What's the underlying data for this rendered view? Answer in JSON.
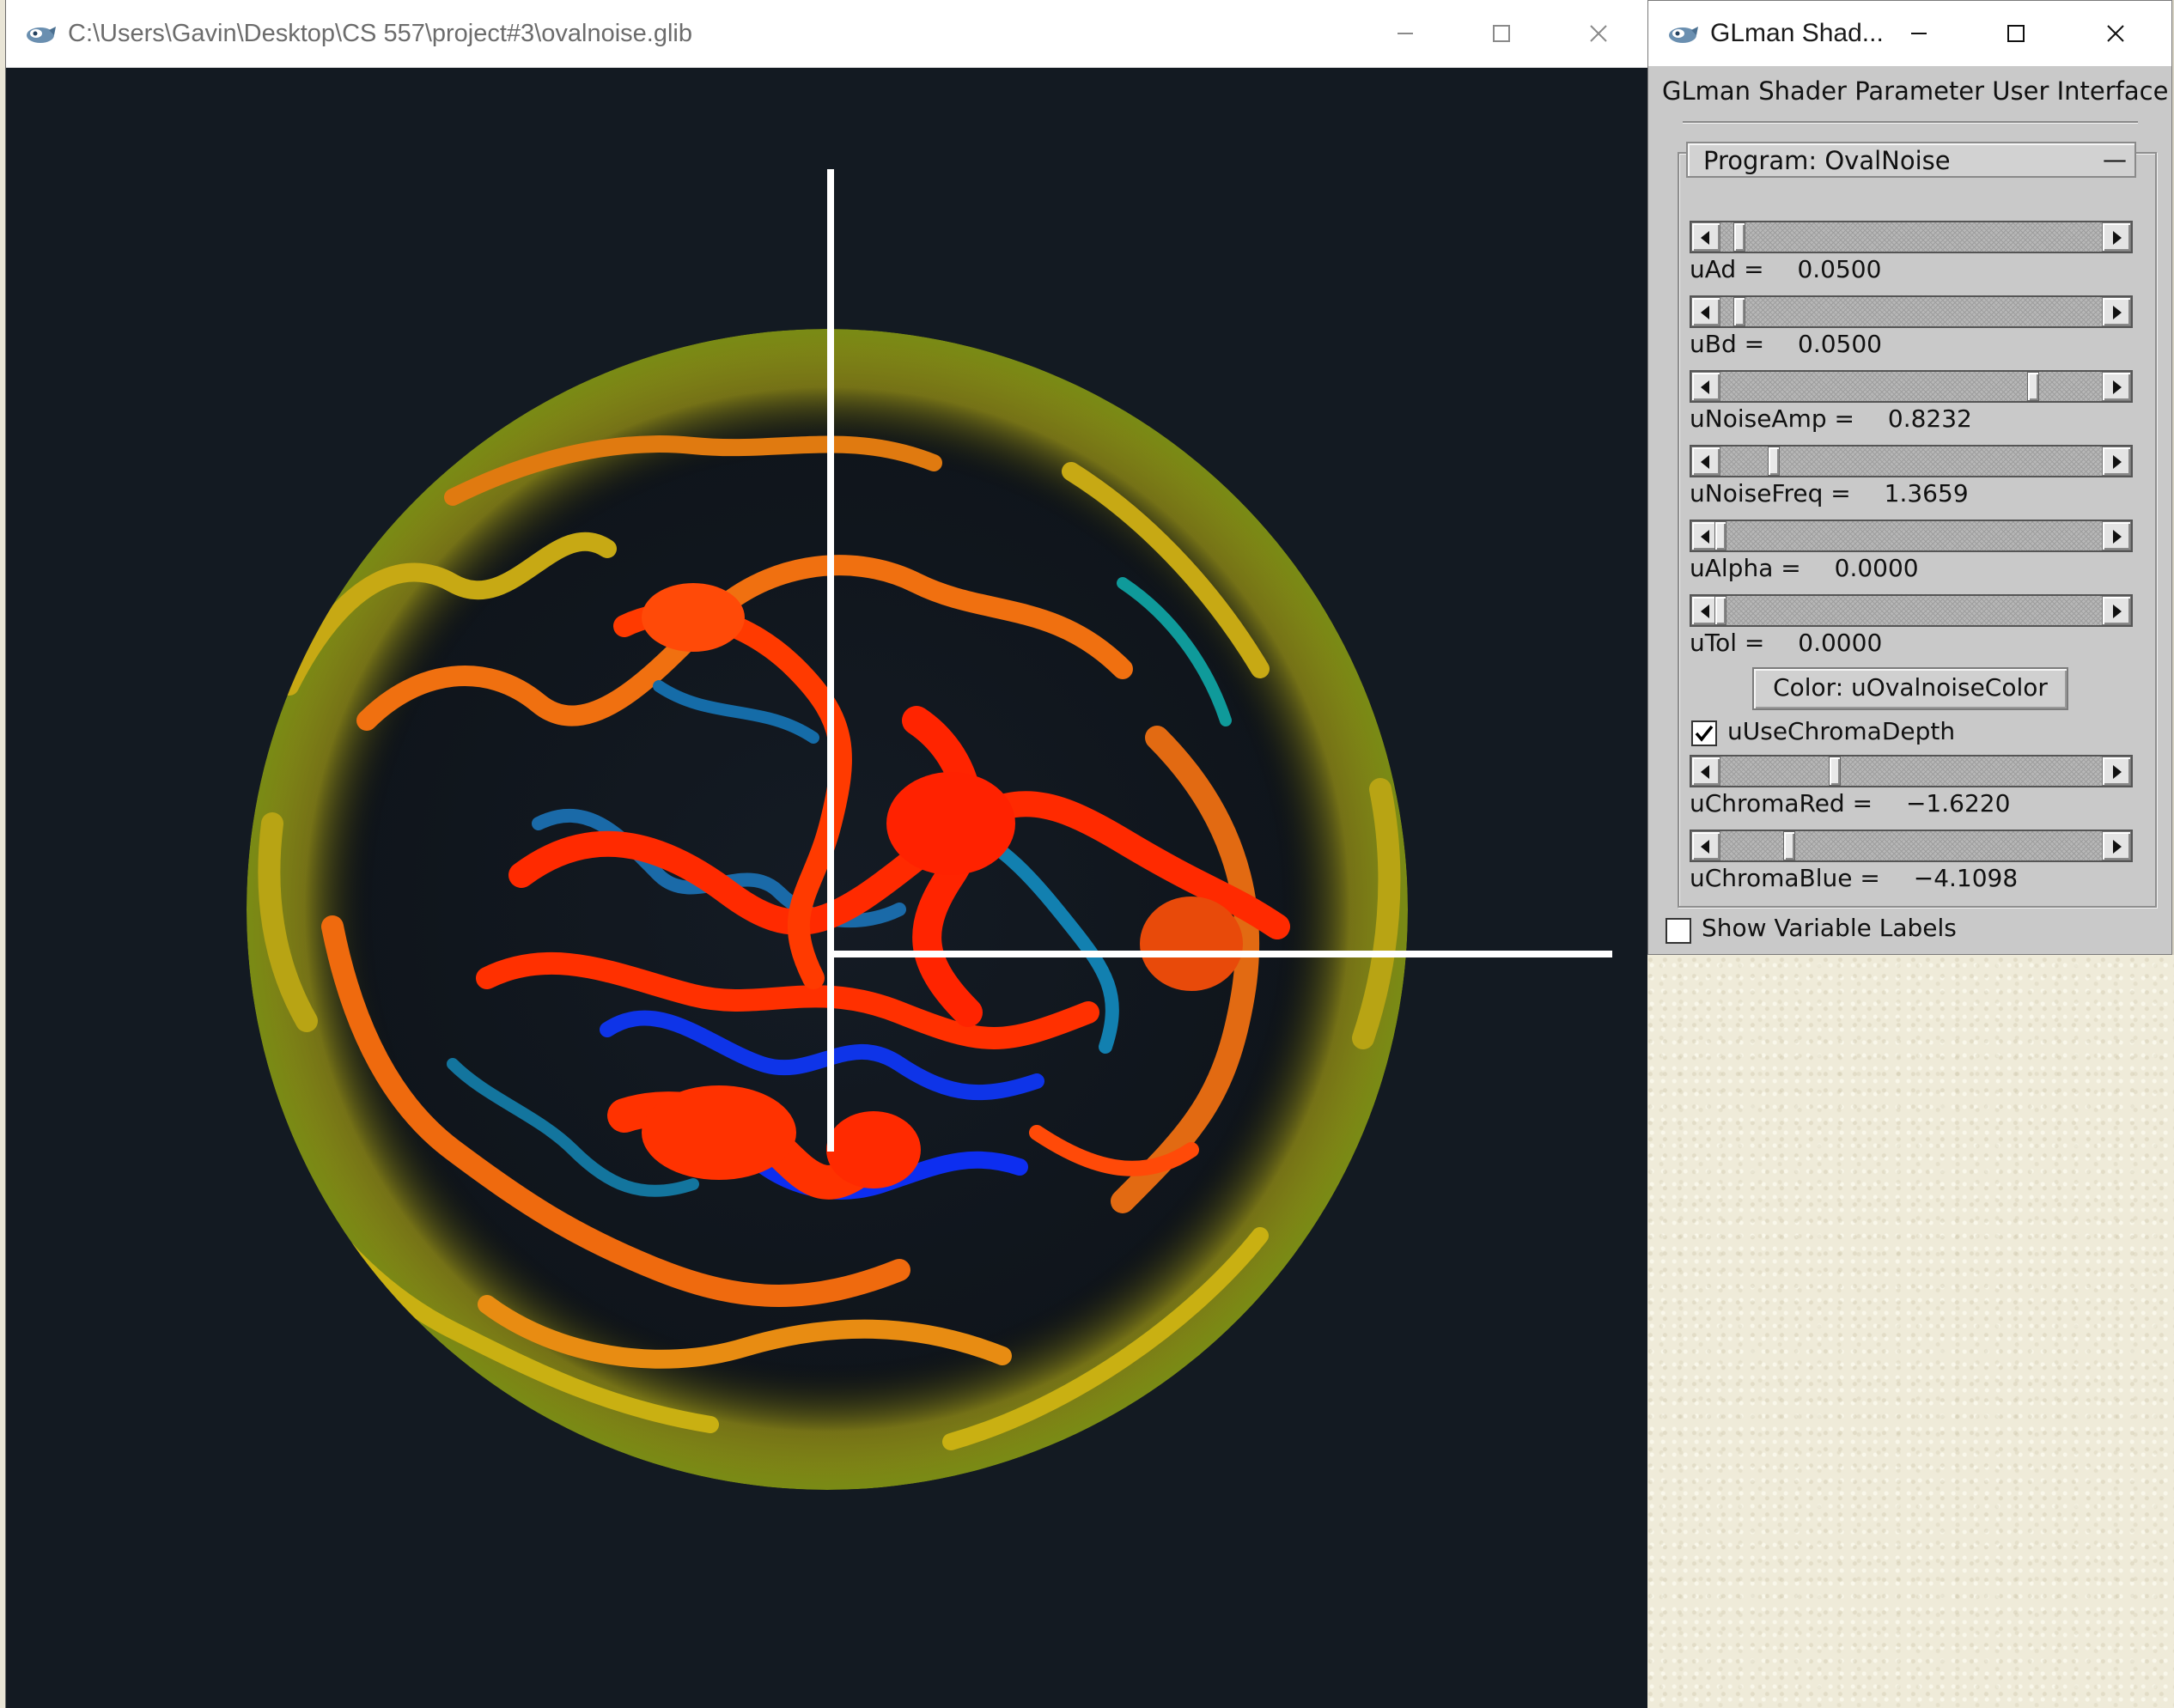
{
  "render_window": {
    "title": "C:\\Users\\Gavin\\Desktop\\CS 557\\project#3\\ovalnoise.glib",
    "controls": {
      "minimize": "minimize",
      "maximize": "maximize",
      "close": "close"
    }
  },
  "scene": {
    "background": "#131a22",
    "axes_color": "#ffffff",
    "pattern_colors": [
      "#ff2a00",
      "#ff6a10",
      "#e8a012",
      "#c8c410",
      "#1477a8",
      "#0d2ef0",
      "#0aa0a0"
    ]
  },
  "glman": {
    "window_title": "GLman Shad...",
    "heading": "GLman Shader Parameter User Interface",
    "program_label": "Program: OvalNoise",
    "collapse_symbol": "—",
    "params": [
      {
        "name": "uAd =",
        "value": "0.0500",
        "fraction": 0.05
      },
      {
        "name": "uBd =",
        "value": "0.0500",
        "fraction": 0.05
      },
      {
        "name": "uNoiseAmp =",
        "value": "0.8232",
        "fraction": 0.82
      },
      {
        "name": "uNoiseFreq =",
        "value": "1.3659",
        "fraction": 0.14
      },
      {
        "name": "uAlpha =",
        "value": "0.0000",
        "fraction": 0.0
      },
      {
        "name": "uTol =",
        "value": "0.0000",
        "fraction": 0.0
      }
    ],
    "color_button_label": "Color: uOvalnoiseColor",
    "chroma_checkbox_label": "uUseChromaDepth",
    "chroma_checked": true,
    "chroma_params": [
      {
        "name": "uChromaRed =",
        "value": "−1.6220",
        "fraction": 0.3
      },
      {
        "name": "uChromaBlue =",
        "value": "−4.1098",
        "fraction": 0.18
      }
    ],
    "show_labels_text": "Show Variable Labels",
    "show_labels_checked": false
  }
}
